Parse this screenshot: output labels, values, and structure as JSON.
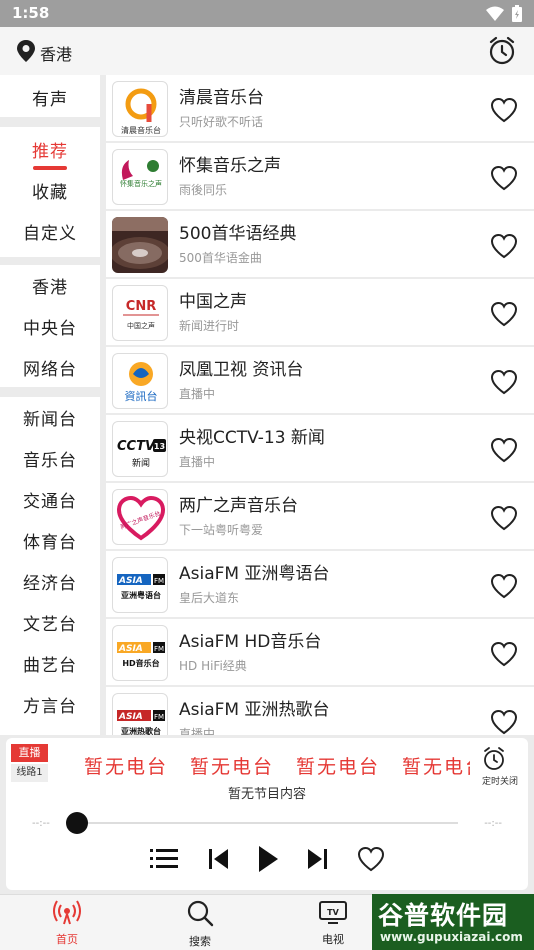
{
  "status_bar": {
    "time": "1:58"
  },
  "header": {
    "location": "香港"
  },
  "sidebar": {
    "group1": [
      "有声"
    ],
    "group2": [
      "推荐",
      "收藏",
      "自定义"
    ],
    "group3": [
      "香港",
      "中央台",
      "网络台"
    ],
    "group4": [
      "新闻台",
      "音乐台",
      "交通台",
      "体育台",
      "经济台",
      "文艺台",
      "曲艺台",
      "方言台"
    ],
    "active": "推荐"
  },
  "stations": [
    {
      "title": "清晨音乐台",
      "subtitle": "只听好歌不听话",
      "logo_text": "清晨音乐台"
    },
    {
      "title": "怀集音乐之声",
      "subtitle": "雨後同乐",
      "logo_text": "怀集音乐之声"
    },
    {
      "title": "500首华语经典",
      "subtitle": "500首华语金曲",
      "logo_text": ""
    },
    {
      "title": "中国之声",
      "subtitle": "新闻进行时",
      "logo_text": "CNR 中国之声"
    },
    {
      "title": "凤凰卫视 资讯台",
      "subtitle": "直播中",
      "logo_text": "資訊台"
    },
    {
      "title": "央视CCTV-13 新闻",
      "subtitle": "直播中",
      "logo_text": "CCTV 13 新闻"
    },
    {
      "title": "两广之声音乐台",
      "subtitle": "下一站粤听粤爱",
      "logo_text": "两广之声音乐台"
    },
    {
      "title": "AsiaFM 亚洲粤语台",
      "subtitle": "皇后大道东",
      "logo_text": "ASIA FM 亚洲粤语台"
    },
    {
      "title": "AsiaFM HD音乐台",
      "subtitle": "HD HiFi经典",
      "logo_text": "ASIA FM HD音乐台"
    },
    {
      "title": "AsiaFM 亚洲热歌台",
      "subtitle": "直播中",
      "logo_text": "ASIA FM 亚洲热歌台"
    }
  ],
  "player": {
    "live_tag": "直播",
    "line_tag": "线路1",
    "now_playing": "暂无电台",
    "program": "暂无节目内容",
    "time_left": "--:--",
    "time_right": "--:--",
    "timer_label": "定时关闭",
    "progress": 0
  },
  "bottom_nav": [
    {
      "label": "首页",
      "icon": "radio-icon",
      "active": true
    },
    {
      "label": "搜索",
      "icon": "search-icon",
      "active": false
    },
    {
      "label": "电视",
      "icon": "tv-icon",
      "active": false
    }
  ],
  "watermark": {
    "main": "谷普软件园",
    "url": "www.gupuxiazai.com"
  },
  "colors": {
    "accent": "#e53935",
    "background": "#ebebeb",
    "card": "#ffffff"
  }
}
